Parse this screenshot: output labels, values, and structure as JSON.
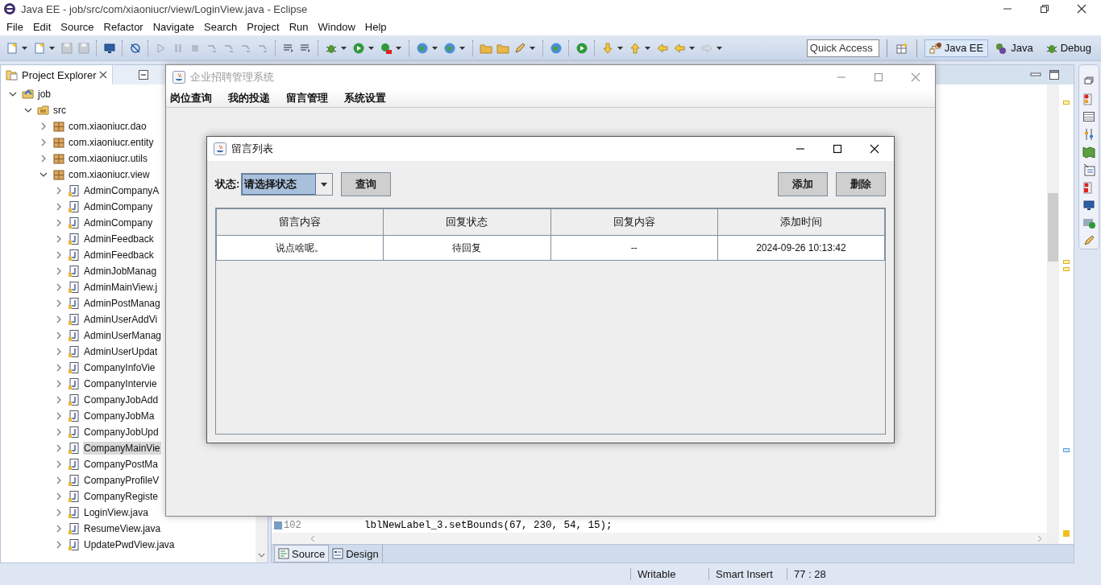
{
  "window": {
    "title": "Java EE - job/src/com/xiaoniucr/view/LoginView.java - Eclipse"
  },
  "menu_bar": [
    "File",
    "Edit",
    "Source",
    "Refactor",
    "Navigate",
    "Search",
    "Project",
    "Run",
    "Window",
    "Help"
  ],
  "toolbar": {
    "quick_access": {
      "placeholder": "Quick Access"
    },
    "perspectives": [
      {
        "label": "Java EE",
        "selected": true
      },
      {
        "label": "Java",
        "selected": false
      },
      {
        "label": "Debug",
        "selected": false
      }
    ]
  },
  "project_explorer": {
    "title": "Project Explorer",
    "tree": [
      {
        "label": "job",
        "kind": "project",
        "expanded": true,
        "selected": false,
        "children": [
          {
            "label": "src",
            "kind": "folder",
            "expanded": true,
            "selected": false,
            "children": [
              {
                "label": "com.xiaoniucr.dao",
                "kind": "package",
                "expanded": false,
                "selected": false
              },
              {
                "label": "com.xiaoniucr.entity",
                "kind": "package",
                "expanded": false,
                "selected": false
              },
              {
                "label": "com.xiaoniucr.utils",
                "kind": "package",
                "expanded": false,
                "selected": false
              },
              {
                "label": "com.xiaoniucr.view",
                "kind": "package",
                "expanded": true,
                "selected": false,
                "children": [
                  {
                    "label": "AdminCompanyA",
                    "kind": "file",
                    "expanded": false,
                    "selected": false
                  },
                  {
                    "label": "AdminCompany",
                    "kind": "file",
                    "expanded": false,
                    "selected": false
                  },
                  {
                    "label": "AdminCompany",
                    "kind": "file",
                    "expanded": false,
                    "selected": false
                  },
                  {
                    "label": "AdminFeedback",
                    "kind": "file",
                    "expanded": false,
                    "selected": false
                  },
                  {
                    "label": "AdminFeedback",
                    "kind": "file",
                    "expanded": false,
                    "selected": false
                  },
                  {
                    "label": "AdminJobManag",
                    "kind": "file",
                    "expanded": false,
                    "selected": false
                  },
                  {
                    "label": "AdminMainView.j",
                    "kind": "file",
                    "expanded": false,
                    "selected": false
                  },
                  {
                    "label": "AdminPostManag",
                    "kind": "file",
                    "expanded": false,
                    "selected": false
                  },
                  {
                    "label": "AdminUserAddVi",
                    "kind": "file",
                    "expanded": false,
                    "selected": false
                  },
                  {
                    "label": "AdminUserManag",
                    "kind": "file",
                    "expanded": false,
                    "selected": false
                  },
                  {
                    "label": "AdminUserUpdat",
                    "kind": "file",
                    "expanded": false,
                    "selected": false
                  },
                  {
                    "label": "CompanyInfoVie",
                    "kind": "file",
                    "expanded": false,
                    "selected": false
                  },
                  {
                    "label": "CompanyIntervie",
                    "kind": "file",
                    "expanded": false,
                    "selected": false
                  },
                  {
                    "label": "CompanyJobAdd",
                    "kind": "file",
                    "expanded": false,
                    "selected": false
                  },
                  {
                    "label": "CompanyJobMa",
                    "kind": "file",
                    "expanded": false,
                    "selected": false
                  },
                  {
                    "label": "CompanyJobUpd",
                    "kind": "file",
                    "expanded": false,
                    "selected": false
                  },
                  {
                    "label": "CompanyMainVie",
                    "kind": "file",
                    "expanded": false,
                    "selected": true
                  },
                  {
                    "label": "CompanyPostMa",
                    "kind": "file",
                    "expanded": false,
                    "selected": false
                  },
                  {
                    "label": "CompanyProfileV",
                    "kind": "file",
                    "expanded": false,
                    "selected": false
                  },
                  {
                    "label": "CompanyRegiste",
                    "kind": "file",
                    "expanded": false,
                    "selected": false
                  },
                  {
                    "label": "LoginView.java",
                    "kind": "file",
                    "expanded": false,
                    "selected": false
                  },
                  {
                    "label": "ResumeView.java",
                    "kind": "file",
                    "expanded": false,
                    "selected": false
                  },
                  {
                    "label": "UpdatePwdView.java",
                    "kind": "file",
                    "expanded": false,
                    "selected": false
                  }
                ]
              }
            ]
          }
        ]
      }
    ]
  },
  "editor": {
    "code_lines": [
      {
        "number": "102",
        "code": "lblNewLabel_3.setBounds(67, 230, 54, 15);"
      }
    ],
    "tabs": [
      {
        "label": "Source",
        "selected": true
      },
      {
        "label": "Design",
        "selected": false
      }
    ]
  },
  "status_bar": [
    "Writable",
    "Smart Insert",
    "77 : 28"
  ],
  "app_window": {
    "title": "企业招聘管理系统",
    "menu": [
      "岗位查询",
      "我的投递",
      "留言管理",
      "系统设置"
    ]
  },
  "dialog": {
    "title": "留言列表",
    "filter": {
      "label": "状态:",
      "value": "请选择状态"
    },
    "search_button": "查询",
    "add_button": "添加",
    "delete_button": "删除",
    "table": {
      "columns": [
        "留言内容",
        "回复状态",
        "回复内容",
        "添加时间"
      ],
      "rows": [
        [
          "说点啥呢。",
          "待回复",
          "--",
          "2024-09-26 10:13:42"
        ]
      ]
    }
  }
}
